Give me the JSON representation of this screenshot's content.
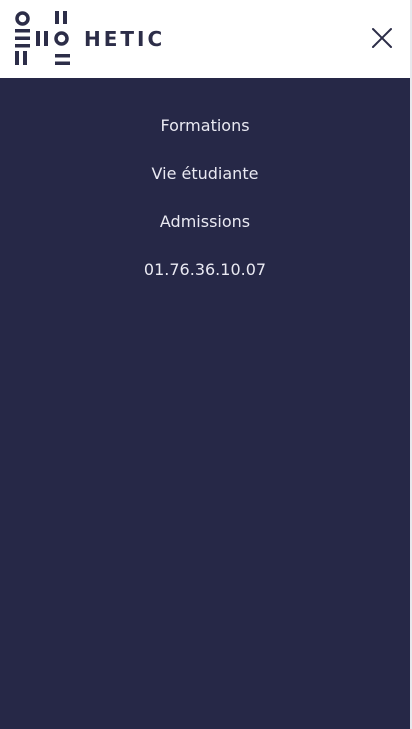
{
  "header": {
    "brand_name": "HETIC",
    "close_icon": "close-icon",
    "logo_icon": "hetic-logo-icon"
  },
  "menu": {
    "items": [
      {
        "label": "Formations"
      },
      {
        "label": "Vie étudiante"
      },
      {
        "label": "Admissions"
      },
      {
        "label": "01.76.36.10.07"
      }
    ]
  },
  "colors": {
    "header_background": "#ffffff",
    "menu_background": "#262847",
    "brand": "#2c2d48",
    "menu_text": "#e9e9f2"
  }
}
